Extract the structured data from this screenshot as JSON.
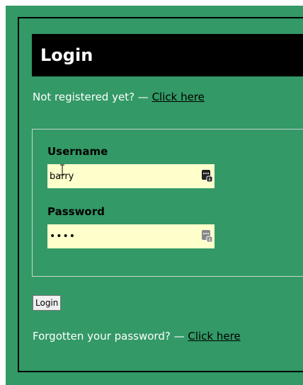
{
  "header": {
    "title": "Login"
  },
  "register": {
    "prompt": "Not registered yet? — ",
    "link": "Click here"
  },
  "form": {
    "username_label": "Username",
    "username_value": "barry",
    "password_label": "Password",
    "password_value": "••••",
    "submit_label": "Login"
  },
  "forgot": {
    "prompt": "Forgotten your password? — ",
    "link": "Click here"
  },
  "colors": {
    "background": "#339966",
    "header": "#000000",
    "input": "#ffffcc"
  }
}
